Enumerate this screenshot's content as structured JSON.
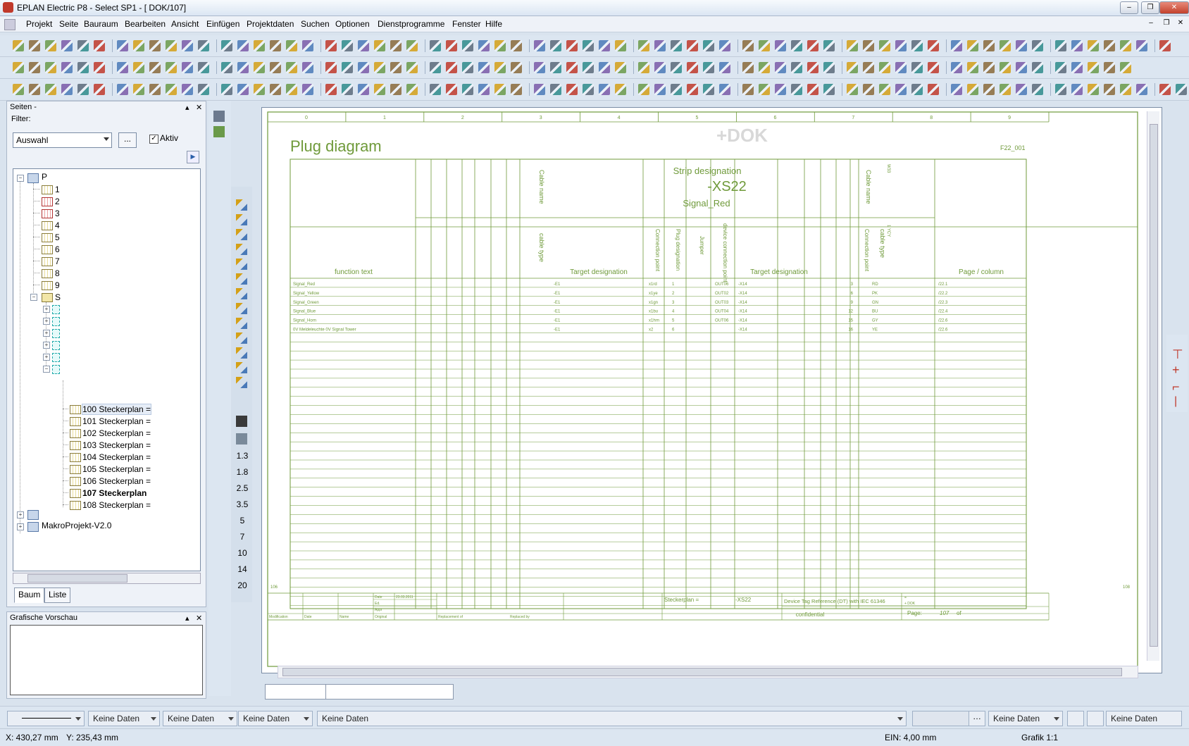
{
  "window": {
    "title": "EPLAN Electric P8 - Select SP1 - [        DOK/107]"
  },
  "menu": [
    "Projekt",
    "Seite",
    "Bauraum",
    "Bearbeiten",
    "Ansicht",
    "Einfügen",
    "Projektdaten",
    "Suchen",
    "Optionen",
    "Dienstprogramme",
    "Fenster",
    "Hilfe"
  ],
  "pages_panel": {
    "title": "Seiten -",
    "filter_label": "Filter:",
    "filter_value": "Auswahl",
    "filter_button": "...",
    "aktiv_label": "Aktiv",
    "aktiv_checked": "✓",
    "tree": {
      "root": "P",
      "pages": [
        "1",
        "2",
        "3",
        "4",
        "5",
        "6",
        "7",
        "8",
        "9"
      ],
      "s_node": "S",
      "stecker_pages": [
        "100 Steckerplan =",
        "101 Steckerplan =",
        "102 Steckerplan =",
        "103 Steckerplan =",
        "104 Steckerplan =",
        "105 Steckerplan =",
        "106 Steckerplan =",
        "107 Steckerplan",
        "108 Steckerplan ="
      ],
      "makro": "MakroProjekt-V2.0"
    },
    "tabs": [
      "Baum",
      "Liste"
    ]
  },
  "preview_panel": {
    "title": "Grafische Vorschau"
  },
  "side_numbers": [
    "1.3",
    "1.8",
    "2.5",
    "3.5",
    "5",
    "7",
    "10",
    "14",
    "20"
  ],
  "drawing": {
    "column_numbers": [
      "0",
      "1",
      "2",
      "3",
      "4",
      "5",
      "6",
      "7",
      "8",
      "9"
    ],
    "title": "Plug diagram",
    "watermark": "+DOK",
    "form_code": "F22_001",
    "strip_designation_label": "Strip designation",
    "strip_designation": "-XS22",
    "strip_name": "Signal_Red",
    "vertical_labels": {
      "cable_name": "Cable name",
      "cable_type": "cable type",
      "connection_point": "Connection point",
      "plug_designation": "Plug designation",
      "jumper": "Jumper",
      "device_connection_point": "device connection point",
      "cable_name2": "Cable name",
      "connection_point2": "Connection point",
      "cable_type2": "cable type",
      "w1": "W33",
      "w2": "1 YCY"
    },
    "headers": {
      "function_text": "function text",
      "target_designation": "Target designation",
      "target_designation2": "Target designation",
      "page_column": "Page / column"
    },
    "rows": [
      {
        "func": "Signal_Red",
        "tgt": "-E1",
        "cp": "x1rd",
        "pd": "1",
        "dcp": "OUT06",
        "tgt2": "-X14",
        "cp2": "3",
        "ct": "RD",
        "page": "/22.1"
      },
      {
        "func": "Signal_Yellow",
        "tgt": "-E1",
        "cp": "x1ye",
        "pd": "2",
        "dcp": "OUT02",
        "tgt2": "-X14",
        "cp2": "6",
        "ct": "PK",
        "page": "/22.2"
      },
      {
        "func": "Signal_Green",
        "tgt": "-E1",
        "cp": "x1gn",
        "pd": "3",
        "dcp": "OUT03",
        "tgt2": "-X14",
        "cp2": "9",
        "ct": "GN",
        "page": "/22.3"
      },
      {
        "func": "Signal_Blue",
        "tgt": "-E1",
        "cp": "x1bu",
        "pd": "4",
        "dcp": "OUT04",
        "tgt2": "-X14",
        "cp2": "12",
        "ct": "BU",
        "page": "/22.4"
      },
      {
        "func": "Signal_Horn",
        "tgt": "-E1",
        "cp": "x1hrn",
        "pd": "5",
        "dcp": "OUT06",
        "tgt2": "-X14",
        "cp2": "15",
        "ct": "GY",
        "page": "/22.6"
      },
      {
        "func": "0V Meldeleuchte 0V Signal Tower",
        "tgt": "-E1",
        "cp": "x2",
        "pd": "6",
        "dcp": "",
        "tgt2": "-X14",
        "cp2": "16",
        "ct": "YE",
        "page": "/22.6"
      }
    ],
    "page_left_num": "106",
    "page_right_num": "108",
    "titleblock": {
      "date_label": "Date",
      "date_value": "23.03.2011",
      "ed_label": "Ed.",
      "appr_label": "Appr",
      "original_label": "Original",
      "modification_label": "Modification",
      "date2_label": "Date",
      "name_label": "Name",
      "replacement_label": "Replacement of",
      "replaced_label": "Replaced by",
      "sheet_name": "Steckerplan =",
      "sheet_tag": "-XS22",
      "dt_ref": "Device Tag Reference (DT) with IEC 61346",
      "confidential": "confidential",
      "eq_mark": "=",
      "dok_mark": "+ DOK",
      "page_label": "Page:",
      "page_num": "107",
      "of_label": "of"
    }
  },
  "doc_tabs": [
    "",
    ""
  ],
  "propbar": {
    "combos": [
      "Keine Daten",
      "Keine Daten",
      "Keine Daten",
      "Keine Daten",
      "Keine Daten",
      "Keine Daten"
    ]
  },
  "status": {
    "x": "X: 430,27 mm",
    "y": "Y: 235,43 mm",
    "ein": "EIN: 4,00 mm",
    "grafik": "Grafik 1:1"
  },
  "colors": {
    "drawing_green": "#6f9a3a",
    "ui_bg": "#dce6f1"
  }
}
